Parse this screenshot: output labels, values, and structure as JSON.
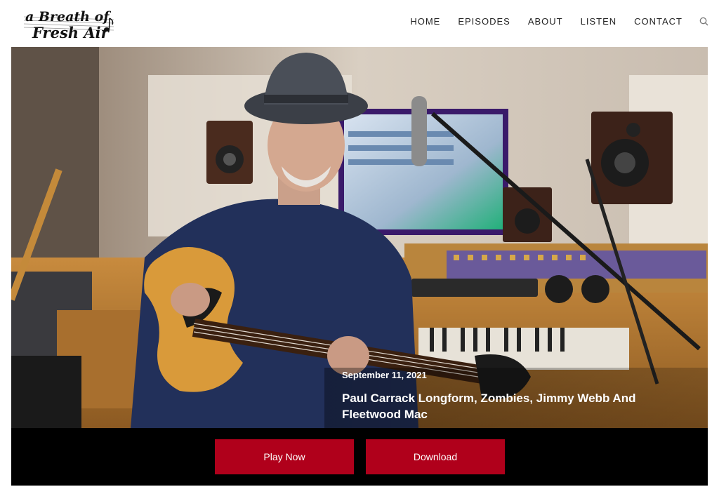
{
  "logo": {
    "line1": "a Breath of",
    "line2": "Fresh Air"
  },
  "nav": {
    "items": [
      {
        "label": "HOME"
      },
      {
        "label": "EPISODES"
      },
      {
        "label": "ABOUT"
      },
      {
        "label": "LISTEN"
      },
      {
        "label": "CONTACT"
      }
    ],
    "search_icon": "search-icon"
  },
  "hero": {
    "date": "September 11, 2021",
    "title": "Paul Carrack Longform, Zombies, Jimmy Webb And Fleetwood Mac"
  },
  "actions": {
    "play_label": "Play Now",
    "download_label": "Download"
  },
  "colors": {
    "accent": "#b0001b",
    "action_bar": "#000000",
    "nav_text": "#222222"
  }
}
